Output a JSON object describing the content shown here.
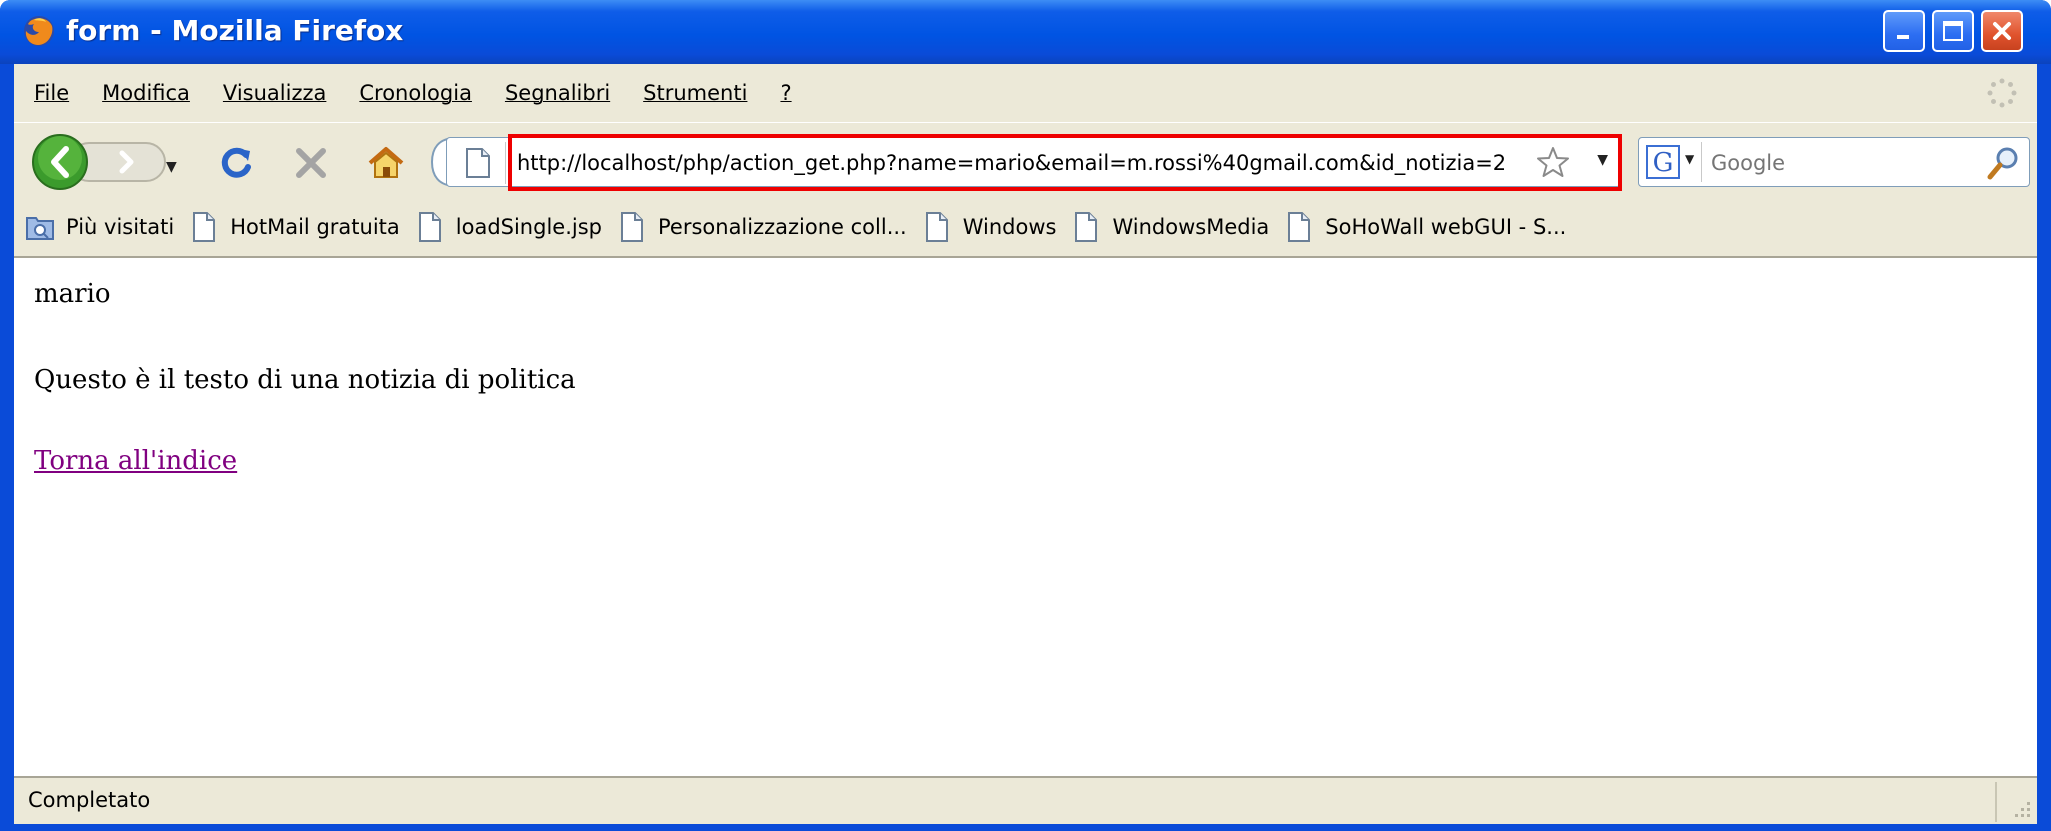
{
  "window": {
    "title": "form - Mozilla Firefox",
    "controls": [
      "minimize-icon",
      "maximize-icon",
      "close-icon"
    ]
  },
  "menubar": {
    "items": [
      "File",
      "Modifica",
      "Visualizza",
      "Cronologia",
      "Segnalibri",
      "Strumenti",
      "?"
    ]
  },
  "navbar": {
    "url": "http://localhost/php/action_get.php?name=mario&email=m.rossi%40gmail.com&id_notizia=2",
    "search_placeholder": "Google",
    "icons": [
      "back-icon",
      "forward-icon",
      "reload-icon",
      "stop-icon",
      "home-icon",
      "page-icon",
      "star-icon",
      "search-icon"
    ]
  },
  "bookmarks": {
    "items": [
      "Più visitati",
      "HotMail gratuita",
      "loadSingle.jsp",
      "Personalizzazione coll...",
      "Windows",
      "WindowsMedia",
      "SoHoWall webGUI - S..."
    ]
  },
  "content": {
    "name": "mario",
    "text": "Questo è il testo di una notizia di politica",
    "link": "Torna all'indice"
  },
  "statusbar": {
    "text": "Completato"
  },
  "colors": {
    "title_bar": "#0054e3",
    "chrome": "#ece9d8",
    "highlight": "#ee0000",
    "visited_link": "#800080"
  }
}
